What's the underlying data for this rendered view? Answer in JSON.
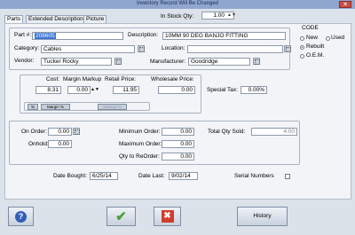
{
  "window": {
    "title": "Inventory Record Will Be Changed",
    "close_glyph": "✕"
  },
  "stock": {
    "label": "In Stock Qty:",
    "value": "1.00"
  },
  "tabs": [
    "Parts",
    "Extended Description",
    "Picture"
  ],
  "part": {
    "part_no_label": "Part #:",
    "part_no": "208605",
    "description_label": "Description:",
    "description": "10MM 90 DEG BANJO FITTING",
    "category_label": "Category:",
    "category": "Cables",
    "location_label": "Location:",
    "location": "",
    "vendor_label": "Vendor:",
    "vendor": "Tucker Rocky",
    "manufacturer_label": "Manufacturer:",
    "manufacturer": "Goodridge"
  },
  "code": {
    "label": "CODE",
    "options": [
      {
        "label": "New",
        "selected": false
      },
      {
        "label": "Used",
        "selected": false
      },
      {
        "label": "Rebuilt",
        "selected": true
      },
      {
        "label": "O.E.M.",
        "selected": false
      }
    ]
  },
  "pricing": {
    "cost_label": "Cost:",
    "cost": "8.31",
    "margin_label": "Margin Markup",
    "margin": "0.00",
    "retail_label": "Retail Price:",
    "retail": "11.95",
    "wholesale_label": "Wholesale Price:",
    "wholesale": "0.00",
    "percent_btn": "%",
    "margin_btn": "Margin %",
    "markup_btn": "Markup %",
    "special_tax_label": "Special Tax:",
    "special_tax": "0.00%"
  },
  "quantities": {
    "on_order_label": "On Order:",
    "on_order": "0.00",
    "onhold_label": "Onhold:",
    "onhold": "0.00",
    "min_order_label": "Minimum Order:",
    "min_order": "0.00",
    "max_order_label": "Maximum Order:",
    "max_order": "0.00",
    "qty_reorder_label": "Qty to ReOrder:",
    "qty_reorder": "0.00",
    "total_sold_label": "Total Qty Sold:",
    "total_sold": "4.00"
  },
  "dates": {
    "bought_label": "Date Bought:",
    "bought": "6/25/14",
    "last_label": "Date Last:",
    "last": "9/02/14",
    "serial_label": "Serial Numbers"
  },
  "footer": {
    "help_glyph": "?",
    "ok_glyph": "✔",
    "cancel_glyph": "✖",
    "history_label": "History"
  }
}
